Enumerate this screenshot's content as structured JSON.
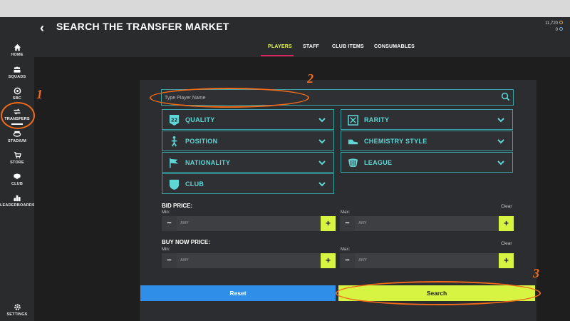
{
  "header": {
    "title": "SEARCH THE TRANSFER MARKET",
    "back_glyph": "‹",
    "coins": "11,720",
    "points": "0"
  },
  "sidebar": {
    "items": [
      {
        "label": "HOME",
        "icon": "home-icon"
      },
      {
        "label": "SQUADS",
        "icon": "squads-icon"
      },
      {
        "label": "SBC",
        "icon": "sbc-icon"
      },
      {
        "label": "TRANSFERS",
        "icon": "transfers-icon"
      },
      {
        "label": "STADIUM",
        "icon": "stadium-icon"
      },
      {
        "label": "STORE",
        "icon": "store-icon"
      },
      {
        "label": "CLUB",
        "icon": "club-icon"
      },
      {
        "label": "LEADERBOARDS",
        "icon": "leaderboards-icon"
      },
      {
        "label": "SETTINGS",
        "icon": "settings-icon"
      }
    ],
    "active": "TRANSFERS"
  },
  "tabs": [
    "PLAYERS",
    "STAFF",
    "CLUB ITEMS",
    "CONSUMABLES"
  ],
  "active_tab": "PLAYERS",
  "search": {
    "placeholder": "Type Player Name"
  },
  "filters": {
    "quality": "QUALITY",
    "quality_badge": "22",
    "rarity": "RARITY",
    "position": "POSITION",
    "chemistry": "CHEMISTRY STYLE",
    "nationality": "NATIONALITY",
    "league": "LEAGUE",
    "club": "CLUB"
  },
  "bid_price": {
    "label": "BID PRICE:",
    "min": "Min:",
    "max": "Max:",
    "clear": "Clear",
    "min_value": "ANY",
    "max_value": "ANY"
  },
  "buy_now_price": {
    "label": "BUY NOW PRICE:",
    "min": "Min:",
    "max": "Max:",
    "clear": "Clear",
    "min_value": "ANY",
    "max_value": "ANY"
  },
  "buttons": {
    "reset": "Reset",
    "search": "Search",
    "minus": "−",
    "plus": "+"
  },
  "annotations": [
    "1",
    "2",
    "3"
  ],
  "colors": {
    "accent_lime": "#d6f441",
    "accent_teal": "#5fd6d6",
    "reset_blue": "#2f8fe8",
    "tab_underline": "#d9255f",
    "annotation_orange": "#f06a1a"
  }
}
